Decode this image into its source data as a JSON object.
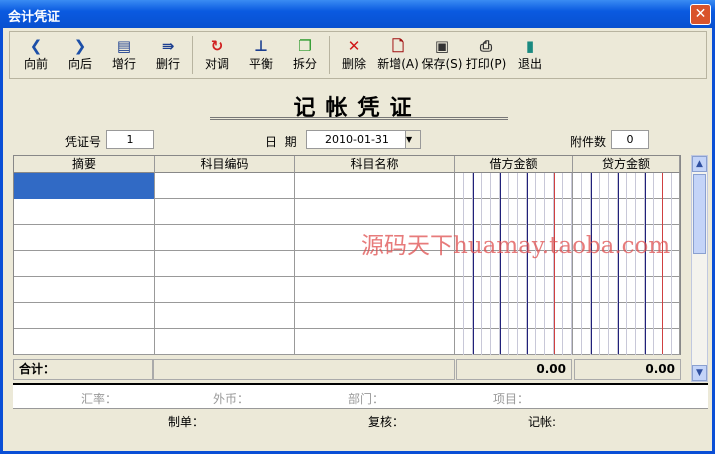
{
  "window": {
    "title": "会计凭证",
    "close_icon": "close-icon"
  },
  "toolbar": [
    {
      "label": "向前",
      "icon": "chevron-left-icon",
      "glyph": "❮",
      "color": "#1c4fa8"
    },
    {
      "label": "向后",
      "icon": "chevron-right-icon",
      "glyph": "❯",
      "color": "#1c4fa8"
    },
    {
      "label": "增行",
      "icon": "insert-row-icon",
      "glyph": "▤",
      "color": "#1c3f90"
    },
    {
      "label": "删行",
      "icon": "delete-row-icon",
      "glyph": "⇛",
      "color": "#1c3f90"
    },
    {
      "label": "对调",
      "icon": "swap-icon",
      "glyph": "↻",
      "color": "#d02020"
    },
    {
      "label": "平衡",
      "icon": "balance-icon",
      "glyph": "⊥",
      "color": "#1c3f90"
    },
    {
      "label": "拆分",
      "icon": "split-icon",
      "glyph": "❐",
      "color": "#2a9a2a"
    },
    {
      "label": "删除",
      "icon": "delete-icon",
      "glyph": "✕",
      "color": "#d01818"
    },
    {
      "label": "新增(A)",
      "icon": "new-document-icon",
      "glyph": "🗋",
      "color": "#a01010"
    },
    {
      "label": "保存(S)",
      "icon": "save-icon",
      "glyph": "▣",
      "color": "#333333"
    },
    {
      "label": "打印(P)",
      "icon": "print-icon",
      "glyph": "⎙",
      "color": "#333333"
    },
    {
      "label": "退出",
      "icon": "exit-icon",
      "glyph": "▮",
      "color": "#1a8a80"
    }
  ],
  "voucher": {
    "title": "记帐凭证",
    "no_label": "凭证号",
    "no_value": "1",
    "date_label": "日  期",
    "date_value": "2010-01-31",
    "attach_label": "附件数",
    "attach_value": "0"
  },
  "table": {
    "columns": [
      "摘要",
      "科目编码",
      "科目名称",
      "借方金额",
      "贷方金额"
    ],
    "rows": 7,
    "total_label": "合计：",
    "debit_total": "0.00",
    "credit_total": "0.00"
  },
  "info": {
    "rate": "汇率：",
    "currency": "外币：",
    "dept": "部门：",
    "project": "项目："
  },
  "footer": {
    "maker": "制单：",
    "reviewer": "复核：",
    "poster": "记帐:"
  },
  "watermark": "源码天下huamay.taoba.com"
}
